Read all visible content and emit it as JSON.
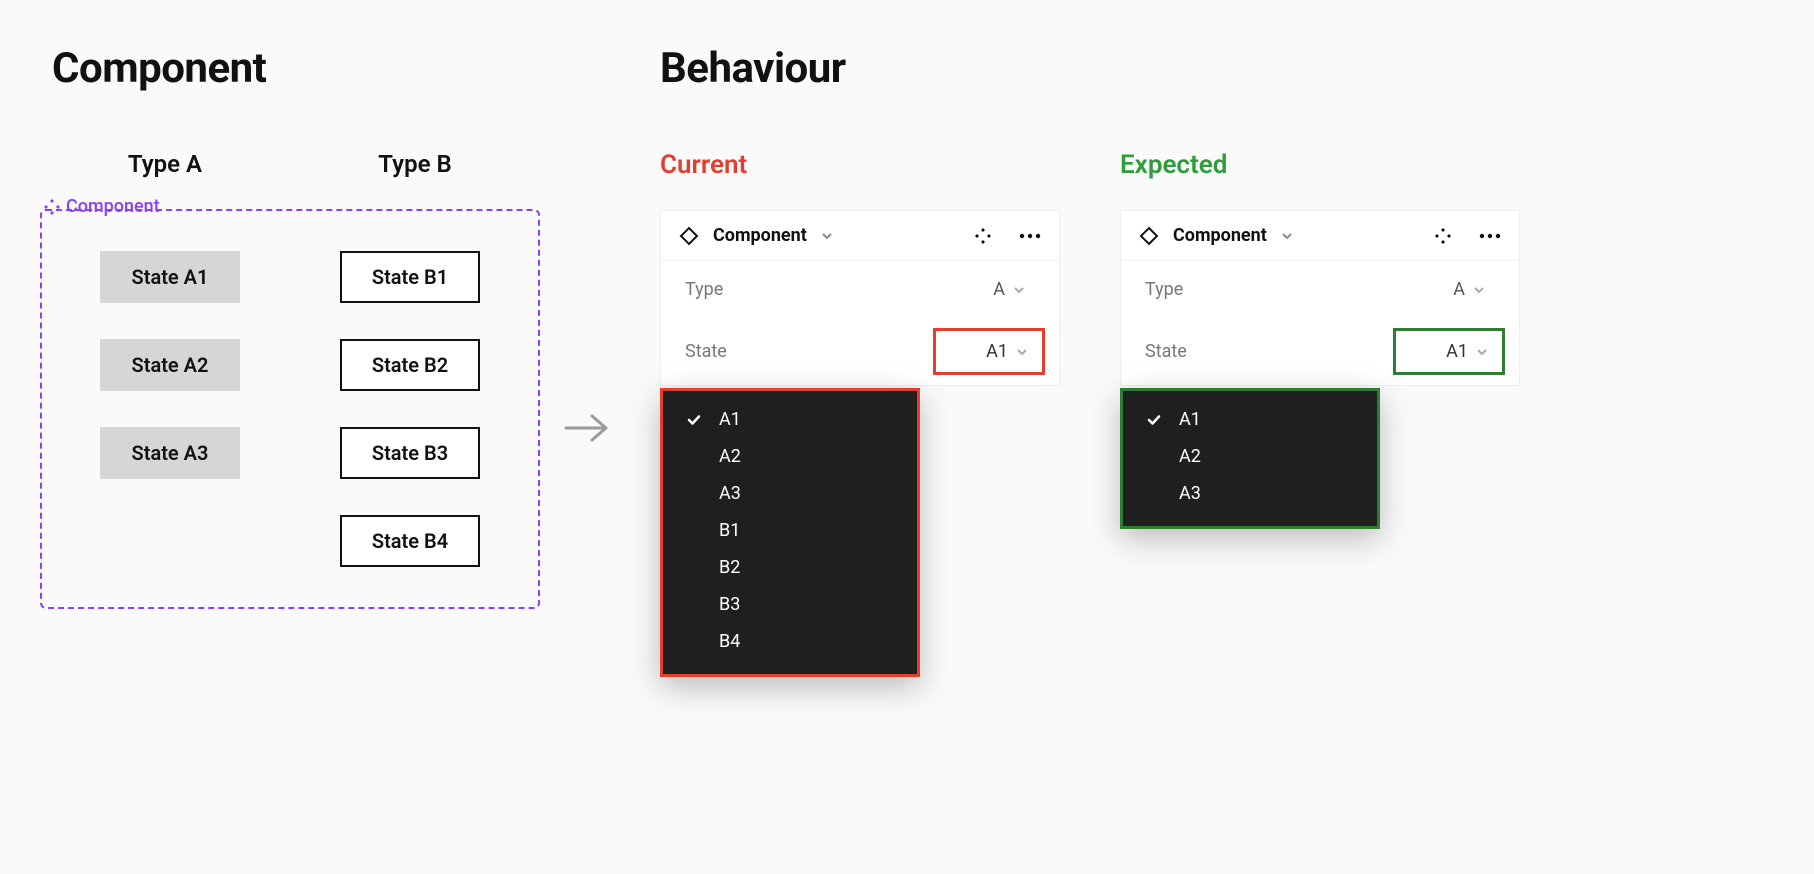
{
  "headings": {
    "component": "Component",
    "behaviour": "Behaviour"
  },
  "componentSet": {
    "label": "Component",
    "typeHeaders": {
      "a": "Type A",
      "b": "Type B"
    },
    "columnA": [
      "State A1",
      "State A2",
      "State A3"
    ],
    "columnB": [
      "State B1",
      "State B2",
      "State B3",
      "State B4"
    ]
  },
  "behaviour": {
    "current": {
      "label": "Current",
      "panelTitle": "Component",
      "typeLabel": "Type",
      "typeValue": "A",
      "stateLabel": "State",
      "stateValue": "A1",
      "dropdown": [
        "A1",
        "A2",
        "A3",
        "B1",
        "B2",
        "B3",
        "B4"
      ],
      "selected": "A1"
    },
    "expected": {
      "label": "Expected",
      "panelTitle": "Component",
      "typeLabel": "Type",
      "typeValue": "A",
      "stateLabel": "State",
      "stateValue": "A1",
      "dropdown": [
        "A1",
        "A2",
        "A3"
      ],
      "selected": "A1"
    }
  },
  "colors": {
    "purple": "#8a3ffc",
    "red": "#e63e2e",
    "green": "#2e9c3b",
    "darkGreen": "#2e7d32",
    "dropdownBg": "#1f1f1f"
  }
}
